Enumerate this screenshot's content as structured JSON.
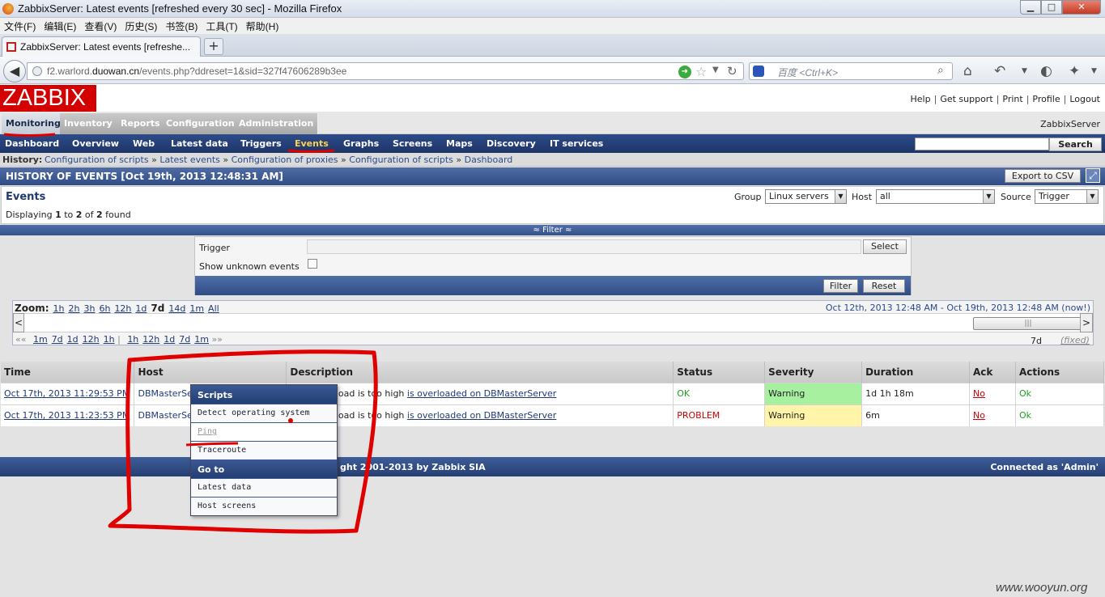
{
  "window": {
    "title": "ZabbixServer: Latest events [refreshed every 30 sec] - Mozilla Firefox",
    "min": "▁",
    "max": "□",
    "close": "✕"
  },
  "menubar": [
    "文件(F)",
    "编辑(E)",
    "查看(V)",
    "历史(S)",
    "书签(B)",
    "工具(T)",
    "帮助(H)"
  ],
  "tab": {
    "label": "ZabbixServer: Latest events [refreshe...",
    "new_tab": "+"
  },
  "address": {
    "prefix": "f2.warlord.",
    "domain": "duowan.cn",
    "path": "/events.php?ddreset=1&sid=327f47606289b3ee"
  },
  "search": {
    "placeholder": "百度 <Ctrl+K>"
  },
  "icons": {
    "back": "back-arrow-icon",
    "go": "go-arrow-icon",
    "star": "bookmark-star-icon",
    "reload": "reload-icon",
    "home": "home-icon"
  },
  "zabbix": {
    "logo": "ZABBIX",
    "top_links": [
      "Help",
      "Get support",
      "Print",
      "Profile",
      "Logout"
    ],
    "main_menu": [
      "Monitoring",
      "Inventory",
      "Reports",
      "Configuration",
      "Administration"
    ],
    "server": "ZabbixServer",
    "sub_menu": [
      "Dashboard",
      "Overview",
      "Web",
      "Latest data",
      "Triggers",
      "Events",
      "Graphs",
      "Screens",
      "Maps",
      "Discovery",
      "IT services"
    ],
    "search_button": "Search",
    "history_label": "History:",
    "history": [
      "Configuration of scripts",
      "Latest events",
      "Configuration of proxies",
      "Configuration of scripts",
      "Dashboard"
    ],
    "page_title": "HISTORY OF EVENTS [Oct 19th, 2013 12:48:31 AM]",
    "export_button": "Export to CSV",
    "events_title": "Events",
    "displaying": {
      "pre": "Displaying ",
      "from": "1",
      "mid1": " to ",
      "to": "2",
      "mid2": " of ",
      "total": "2",
      "post": " found"
    },
    "filters": {
      "group_label": "Group",
      "group_value": "Linux servers",
      "host_label": "Host",
      "host_value": "all",
      "source_label": "Source",
      "source_value": "Trigger"
    },
    "filter_toggle": "≈ Filter ≈",
    "filter_form": {
      "trigger_label": "Trigger",
      "select_button": "Select",
      "unknown_label": "Show unknown events",
      "filter_button": "Filter",
      "reset_button": "Reset"
    },
    "timeline": {
      "zoom_label": "Zoom:",
      "zoom_links": [
        "1h",
        "2h",
        "3h",
        "6h",
        "12h",
        "1d"
      ],
      "zoom_current": "7d",
      "zoom_links2": [
        "14d",
        "1m",
        "All"
      ],
      "range_text": "Oct 12th, 2013 12:48 AM  -  Oct 19th, 2013 12:48 AM (now!)",
      "step_back_arrows": "«« ",
      "step_back": [
        "1m",
        "7d",
        "1d",
        "12h",
        "1h"
      ],
      "step_sep": " | ",
      "step_fwd": [
        "1h",
        "12h",
        "1d",
        "7d",
        "1m"
      ],
      "step_fwd_arrows": " »»",
      "period": "7d",
      "fixed": "(fixed)",
      "left_arrow": "<",
      "right_arrow": ">"
    },
    "table": {
      "headers": [
        "Time",
        "Host",
        "Description",
        "Status",
        "Severity",
        "Duration",
        "Ack",
        "Actions"
      ],
      "rows": [
        {
          "time": "Oct 17th, 2013 11:29:53 PM",
          "host": "DBMasterServer",
          "desc_pre": "Processor load is too high ",
          "desc_link": "is overloaded on DBMasterServer",
          "status": "OK",
          "severity": "Warning",
          "duration": "1d 1h 18m",
          "ack": "No",
          "actions": "Ok"
        },
        {
          "time": "Oct 17th, 2013 11:23:53 PM",
          "host": "DBMasterServer",
          "desc_pre": "Processor load is too high ",
          "desc_link": "is overloaded on DBMasterServer",
          "status": "PROBLEM",
          "severity": "Warning",
          "duration": "6m",
          "ack": "No",
          "actions": "Ok"
        }
      ]
    },
    "context_menu": {
      "scripts_header": "Scripts",
      "scripts": [
        "Detect operating system",
        "Ping",
        "Traceroute"
      ],
      "goto_header": "Go to",
      "goto": [
        "Latest data",
        "Host screens"
      ]
    },
    "footer": {
      "copyright": "Zabbix 2.0.x Copyright 2001-2013 by Zabbix SIA",
      "copyright_visible": "ght 2001-2013 by Zabbix SIA",
      "connected": "Connected as 'Admin'"
    }
  },
  "watermark": "www.wooyun.org",
  "annotation_color": "#e00000"
}
